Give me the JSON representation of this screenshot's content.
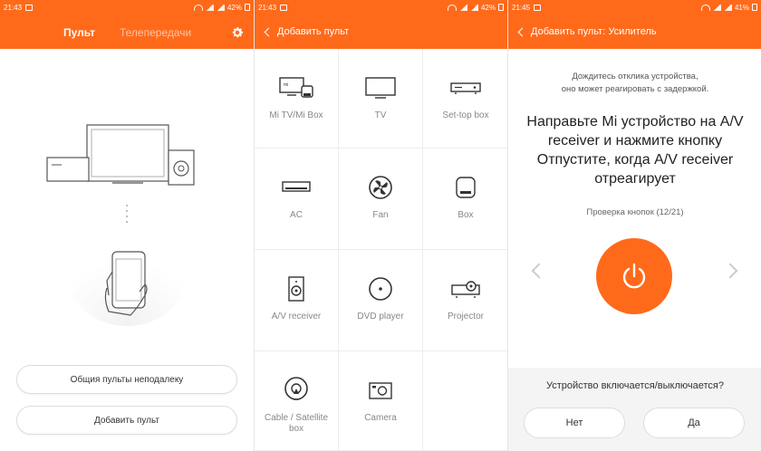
{
  "panel1": {
    "status": {
      "time": "21:43",
      "battery": "42%"
    },
    "tabs": {
      "active": "Пульт",
      "inactive": "Телепередачи"
    },
    "buttons": {
      "nearby": "Общия пульты неподалеку",
      "add": "Добавить пульт"
    }
  },
  "panel2": {
    "status": {
      "time": "21:43",
      "battery": "42%"
    },
    "title": "Добавить пульт",
    "devices": [
      {
        "label": "Mi TV/Mi Box",
        "icon": "mi-tv-box-icon"
      },
      {
        "label": "TV",
        "icon": "tv-icon"
      },
      {
        "label": "Set-top box",
        "icon": "set-top-box-icon"
      },
      {
        "label": "AC",
        "icon": "ac-icon"
      },
      {
        "label": "Fan",
        "icon": "fan-icon"
      },
      {
        "label": "Box",
        "icon": "box-icon"
      },
      {
        "label": "A/V receiver",
        "icon": "av-receiver-icon"
      },
      {
        "label": "DVD player",
        "icon": "dvd-player-icon"
      },
      {
        "label": "Projector",
        "icon": "projector-icon"
      },
      {
        "label": "Cable / Satellite box",
        "icon": "satellite-icon"
      },
      {
        "label": "Camera",
        "icon": "camera-icon"
      }
    ]
  },
  "panel3": {
    "status": {
      "time": "21:45",
      "battery": "41%"
    },
    "title": "Добавить пульт: Усилитель",
    "hint_line1": "Дождитесь отклика устройства,",
    "hint_line2": "оно может реагировать с задержкой.",
    "instruction_line1": "Направьте Mi устройство на A/V",
    "instruction_line2": "receiver и нажмите кнопку",
    "instruction_line3": "Отпустите, когда A/V receiver",
    "instruction_line4": "отреагирует",
    "check": "Проверка кнопок (12/21)",
    "question": "Устройство включается/выключается?",
    "no": "Нет",
    "yes": "Да"
  },
  "colors": {
    "accent": "#ff6a1a",
    "bg": "#ffffff"
  }
}
